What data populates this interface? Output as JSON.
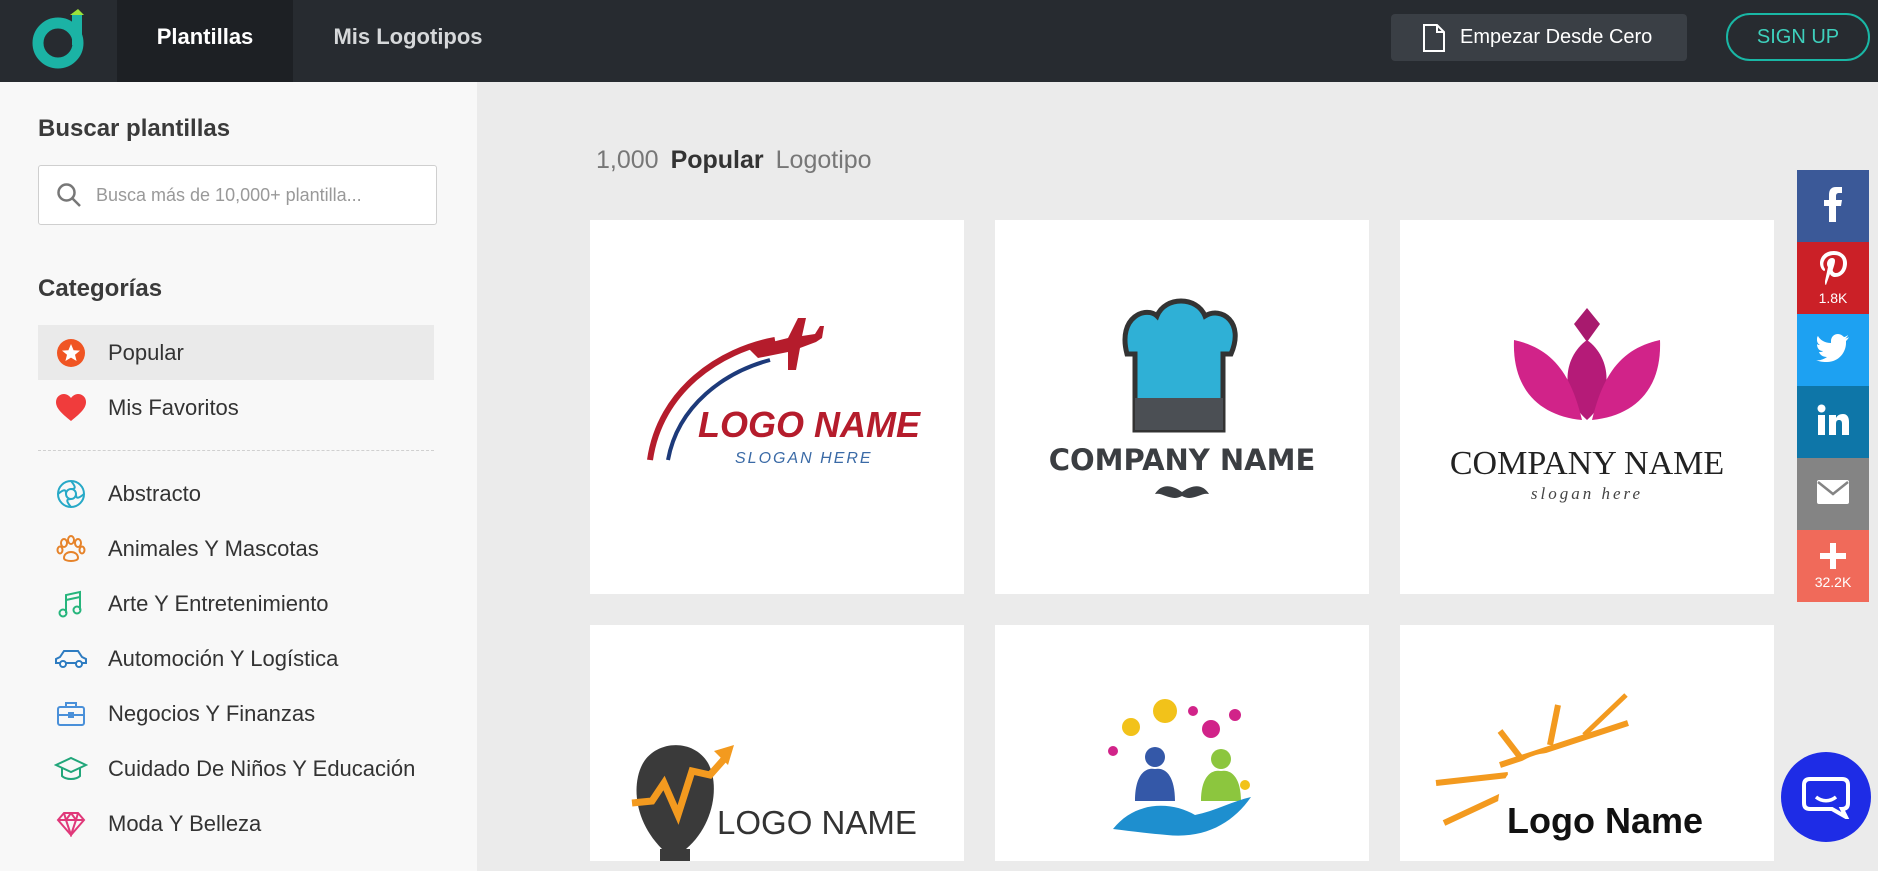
{
  "nav": {
    "tabs": [
      {
        "label": "Plantillas",
        "active": true
      },
      {
        "label": "Mis Logotipos",
        "active": false
      }
    ],
    "blank_button": "Empezar Desde Cero",
    "signup": "SIGN UP"
  },
  "sidebar": {
    "search_title": "Buscar plantillas",
    "search_placeholder": "Busca más de 10,000+ plantilla...",
    "categories_title": "Categorías",
    "primary": [
      {
        "label": "Popular",
        "icon": "star-icon",
        "active": true
      },
      {
        "label": "Mis Favoritos",
        "icon": "heart-icon",
        "active": false
      }
    ],
    "categories": [
      {
        "label": "Abstracto",
        "icon": "swirl-icon"
      },
      {
        "label": "Animales Y Mascotas",
        "icon": "paw-icon"
      },
      {
        "label": "Arte Y Entretenimiento",
        "icon": "music-note-icon"
      },
      {
        "label": "Automoción Y Logística",
        "icon": "car-icon"
      },
      {
        "label": "Negocios Y Finanzas",
        "icon": "briefcase-icon"
      },
      {
        "label": "Cuidado De Niños Y Educación",
        "icon": "graduation-cap-icon"
      },
      {
        "label": "Moda Y Belleza",
        "icon": "diamond-icon"
      }
    ]
  },
  "main": {
    "count": "1,000",
    "category": "Popular",
    "type": "Logotipo",
    "templates": [
      {
        "title": "LOGO NAME",
        "slogan": "SLOGAN HERE",
        "icon": "airplane-logo-icon"
      },
      {
        "title": "COMPANY NAME",
        "slogan": "",
        "icon": "chef-hat-logo-icon"
      },
      {
        "title": "COMPANY NAME",
        "slogan": "slogan here",
        "icon": "lotus-logo-icon"
      },
      {
        "title": "LOGO NAME",
        "slogan": "",
        "icon": "bulb-logo-icon"
      },
      {
        "title": "",
        "slogan": "",
        "icon": "people-hand-logo-icon"
      },
      {
        "title": "Logo Name",
        "slogan": "",
        "icon": "sun-logo-icon"
      }
    ]
  },
  "share": [
    {
      "network": "facebook",
      "icon": "facebook-icon",
      "color": "#3b5998",
      "count": ""
    },
    {
      "network": "pinterest",
      "icon": "pinterest-icon",
      "color": "#cb2027",
      "count": "1.8K"
    },
    {
      "network": "twitter",
      "icon": "twitter-icon",
      "color": "#1da1f2",
      "count": ""
    },
    {
      "network": "linkedin",
      "icon": "linkedin-icon",
      "color": "#0e76a8",
      "count": ""
    },
    {
      "network": "email",
      "icon": "email-icon",
      "color": "#848484",
      "count": ""
    },
    {
      "network": "more",
      "icon": "plus-icon",
      "color": "#f06a5a",
      "count": "32.2K"
    }
  ],
  "colors": {
    "topbar": "#272b30",
    "accent": "#19b7a5",
    "chat": "#1e2ce6"
  }
}
